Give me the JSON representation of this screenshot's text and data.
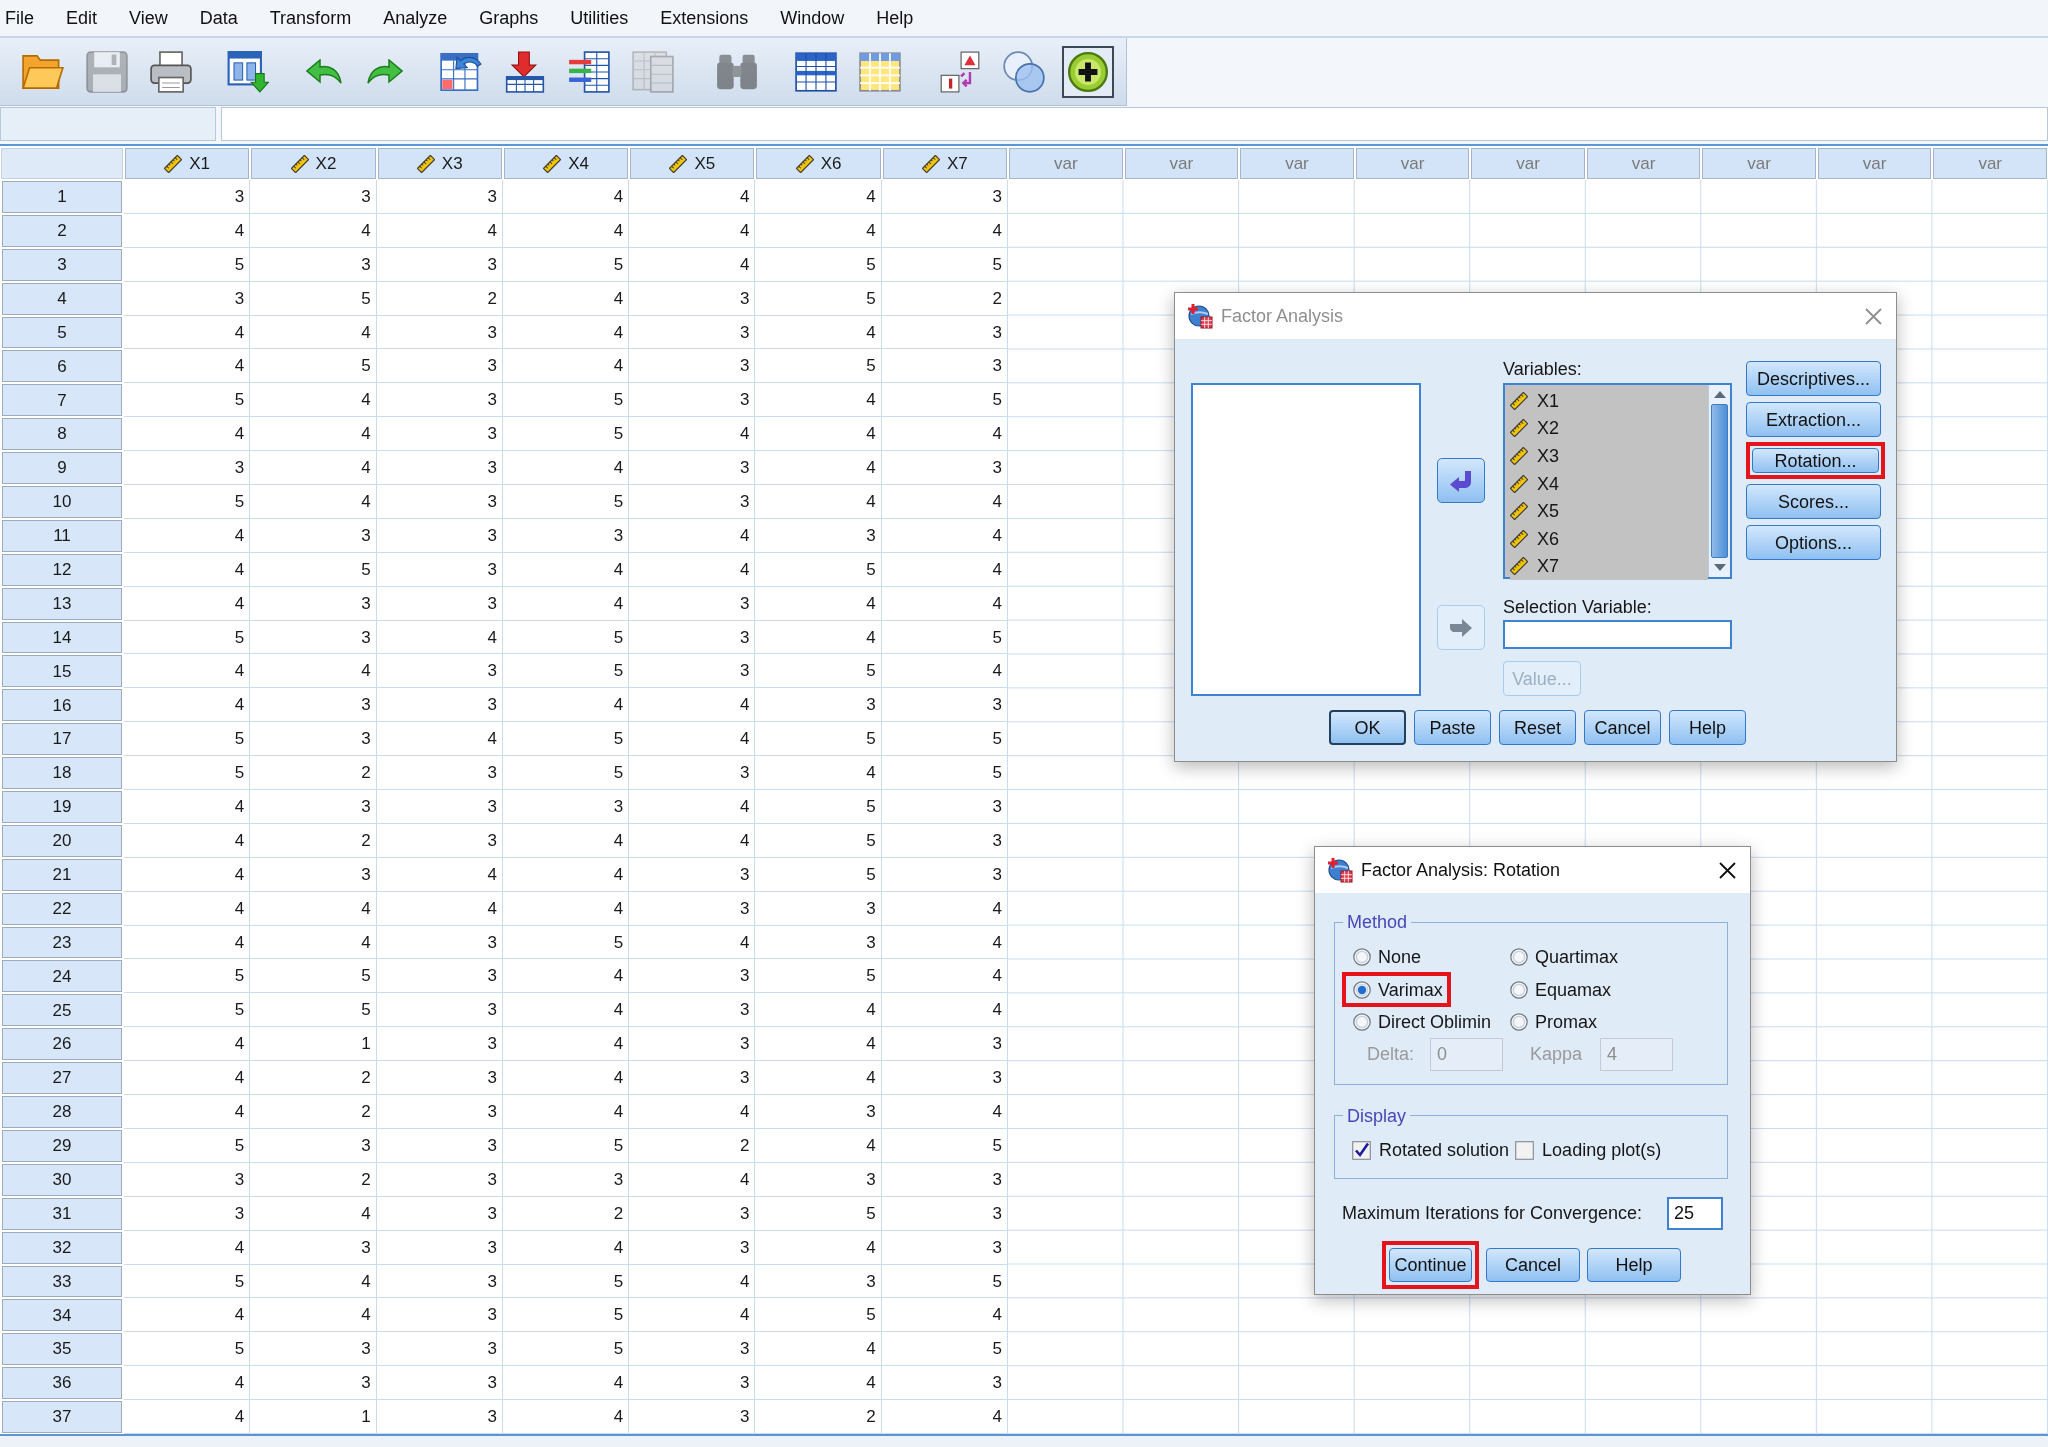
{
  "menu_bar": [
    "File",
    "Edit",
    "View",
    "Data",
    "Transform",
    "Analyze",
    "Graphs",
    "Utilities",
    "Extensions",
    "Window",
    "Help"
  ],
  "toolbar": [
    {
      "disabled": false,
      "on": false
    },
    {
      "disabled": true,
      "on": false
    },
    {
      "disabled": false,
      "on": false
    },
    {
      "disabled": false,
      "on": false
    },
    {
      "disabled": false,
      "on": false
    },
    {
      "disabled": false,
      "on": false
    },
    {
      "disabled": false,
      "on": false
    },
    {
      "disabled": false,
      "on": false
    },
    {
      "disabled": false,
      "on": false
    },
    {
      "disabled": true,
      "on": false
    },
    {
      "disabled": true,
      "on": false
    },
    {
      "disabled": false,
      "on": false
    },
    {
      "disabled": false,
      "on": false
    },
    {
      "disabled": false,
      "on": false
    },
    {
      "disabled": false,
      "on": false
    },
    {
      "disabled": false,
      "on": true
    }
  ],
  "grid": {
    "columns": [
      {
        "label": "X1",
        "kind": "scale"
      },
      {
        "label": "X2",
        "kind": "scale"
      },
      {
        "label": "X3",
        "kind": "scale"
      },
      {
        "label": "X4",
        "kind": "scale"
      },
      {
        "label": "X5",
        "kind": "scale"
      },
      {
        "label": "X6",
        "kind": "scale"
      },
      {
        "label": "X7",
        "kind": "scale"
      },
      {
        "label": "var",
        "kind": "empty"
      },
      {
        "label": "var",
        "kind": "empty"
      },
      {
        "label": "var",
        "kind": "empty"
      },
      {
        "label": "var",
        "kind": "empty"
      },
      {
        "label": "var",
        "kind": "empty"
      },
      {
        "label": "var",
        "kind": "empty"
      },
      {
        "label": "var",
        "kind": "empty"
      },
      {
        "label": "var",
        "kind": "empty"
      },
      {
        "label": "var",
        "kind": "empty"
      }
    ],
    "rows": [
      {
        "number": "1",
        "cells": [
          "3",
          "3",
          "3",
          "4",
          "4",
          "4",
          "3"
        ]
      },
      {
        "number": "2",
        "cells": [
          "4",
          "4",
          "4",
          "4",
          "4",
          "4",
          "4"
        ]
      },
      {
        "number": "3",
        "cells": [
          "5",
          "3",
          "3",
          "5",
          "4",
          "5",
          "5"
        ]
      },
      {
        "number": "4",
        "cells": [
          "3",
          "5",
          "2",
          "4",
          "3",
          "5",
          "2"
        ]
      },
      {
        "number": "5",
        "cells": [
          "4",
          "4",
          "3",
          "4",
          "3",
          "4",
          "3"
        ]
      },
      {
        "number": "6",
        "cells": [
          "4",
          "5",
          "3",
          "4",
          "3",
          "5",
          "3"
        ]
      },
      {
        "number": "7",
        "cells": [
          "5",
          "4",
          "3",
          "5",
          "3",
          "4",
          "5"
        ]
      },
      {
        "number": "8",
        "cells": [
          "4",
          "4",
          "3",
          "5",
          "4",
          "4",
          "4"
        ]
      },
      {
        "number": "9",
        "cells": [
          "3",
          "4",
          "3",
          "4",
          "3",
          "4",
          "3"
        ]
      },
      {
        "number": "10",
        "cells": [
          "5",
          "4",
          "3",
          "5",
          "3",
          "4",
          "4"
        ]
      },
      {
        "number": "11",
        "cells": [
          "4",
          "3",
          "3",
          "3",
          "4",
          "3",
          "4"
        ]
      },
      {
        "number": "12",
        "cells": [
          "4",
          "5",
          "3",
          "4",
          "4",
          "5",
          "4"
        ]
      },
      {
        "number": "13",
        "cells": [
          "4",
          "3",
          "3",
          "4",
          "3",
          "4",
          "4"
        ]
      },
      {
        "number": "14",
        "cells": [
          "5",
          "3",
          "4",
          "5",
          "3",
          "4",
          "5"
        ]
      },
      {
        "number": "15",
        "cells": [
          "4",
          "4",
          "3",
          "5",
          "3",
          "5",
          "4"
        ]
      },
      {
        "number": "16",
        "cells": [
          "4",
          "3",
          "3",
          "4",
          "4",
          "3",
          "3"
        ]
      },
      {
        "number": "17",
        "cells": [
          "5",
          "3",
          "4",
          "5",
          "4",
          "5",
          "5"
        ]
      },
      {
        "number": "18",
        "cells": [
          "5",
          "2",
          "3",
          "5",
          "3",
          "4",
          "5"
        ]
      },
      {
        "number": "19",
        "cells": [
          "4",
          "3",
          "3",
          "3",
          "4",
          "5",
          "3"
        ]
      },
      {
        "number": "20",
        "cells": [
          "4",
          "2",
          "3",
          "4",
          "4",
          "5",
          "3"
        ]
      },
      {
        "number": "21",
        "cells": [
          "4",
          "3",
          "4",
          "4",
          "3",
          "5",
          "3"
        ]
      },
      {
        "number": "22",
        "cells": [
          "4",
          "4",
          "4",
          "4",
          "3",
          "3",
          "4"
        ]
      },
      {
        "number": "23",
        "cells": [
          "4",
          "4",
          "3",
          "5",
          "4",
          "3",
          "4"
        ]
      },
      {
        "number": "24",
        "cells": [
          "5",
          "5",
          "3",
          "4",
          "3",
          "5",
          "4"
        ]
      },
      {
        "number": "25",
        "cells": [
          "5",
          "5",
          "3",
          "4",
          "3",
          "4",
          "4"
        ]
      },
      {
        "number": "26",
        "cells": [
          "4",
          "1",
          "3",
          "4",
          "3",
          "4",
          "3"
        ]
      },
      {
        "number": "27",
        "cells": [
          "4",
          "2",
          "3",
          "4",
          "3",
          "4",
          "3"
        ]
      },
      {
        "number": "28",
        "cells": [
          "4",
          "2",
          "3",
          "4",
          "4",
          "3",
          "4"
        ]
      },
      {
        "number": "29",
        "cells": [
          "5",
          "3",
          "3",
          "5",
          "2",
          "4",
          "5"
        ]
      },
      {
        "number": "30",
        "cells": [
          "3",
          "2",
          "3",
          "3",
          "4",
          "3",
          "3"
        ]
      },
      {
        "number": "31",
        "cells": [
          "3",
          "4",
          "3",
          "2",
          "3",
          "5",
          "3"
        ]
      },
      {
        "number": "32",
        "cells": [
          "4",
          "3",
          "3",
          "4",
          "3",
          "4",
          "3"
        ]
      },
      {
        "number": "33",
        "cells": [
          "5",
          "4",
          "3",
          "5",
          "4",
          "3",
          "5"
        ]
      },
      {
        "number": "34",
        "cells": [
          "4",
          "4",
          "3",
          "5",
          "4",
          "5",
          "4"
        ]
      },
      {
        "number": "35",
        "cells": [
          "5",
          "3",
          "3",
          "5",
          "3",
          "4",
          "5"
        ]
      },
      {
        "number": "36",
        "cells": [
          "4",
          "3",
          "3",
          "4",
          "3",
          "4",
          "3"
        ]
      },
      {
        "number": "37",
        "cells": [
          "4",
          "1",
          "3",
          "4",
          "3",
          "2",
          "4"
        ]
      }
    ]
  },
  "factor_analysis_dialog": {
    "title": "Factor Analysis",
    "active": false,
    "variables_label": "Variables:",
    "variables": [
      {
        "name": "X1",
        "selected": true
      },
      {
        "name": "X2",
        "selected": true
      },
      {
        "name": "X3",
        "selected": true
      },
      {
        "name": "X4",
        "selected": true
      },
      {
        "name": "X5",
        "selected": true
      },
      {
        "name": "X6",
        "selected": true
      },
      {
        "name": "X7",
        "selected": true
      }
    ],
    "move_buttons": [
      {
        "disabled": false
      },
      {
        "disabled": true
      }
    ],
    "selection_variable_label": "Selection Variable:",
    "value_button": {
      "label": "Value...",
      "disabled": true
    },
    "side_buttons": [
      {
        "label": "Descriptives...",
        "highlighted": false
      },
      {
        "label": "Extraction...",
        "highlighted": false
      },
      {
        "label": "Rotation...",
        "highlighted": true
      },
      {
        "label": "Scores...",
        "highlighted": false
      },
      {
        "label": "Options...",
        "highlighted": false
      }
    ],
    "bottom_buttons": [
      {
        "label": "OK",
        "default": true
      },
      {
        "label": "Paste",
        "default": false
      },
      {
        "label": "Reset",
        "default": false
      },
      {
        "label": "Cancel",
        "default": false
      },
      {
        "label": "Help",
        "default": false
      }
    ]
  },
  "rotation_dialog": {
    "title": "Factor Analysis: Rotation",
    "active": true,
    "method": {
      "legend": "Method",
      "options": [
        {
          "label": "None",
          "selected": false,
          "highlighted": false
        },
        {
          "label": "Quartimax",
          "selected": false,
          "highlighted": false
        },
        {
          "label": "Varimax",
          "selected": true,
          "highlighted": true
        },
        {
          "label": "Equamax",
          "selected": false,
          "highlighted": false
        },
        {
          "label": "Direct Oblimin",
          "selected": false,
          "highlighted": false
        },
        {
          "label": "Promax",
          "selected": false,
          "highlighted": false
        }
      ],
      "parameters": [
        {
          "label": "Delta:",
          "value": "0",
          "disabled": true
        },
        {
          "label": "Kappa",
          "value": "4",
          "disabled": true
        }
      ]
    },
    "display": {
      "legend": "Display",
      "options": [
        {
          "label": "Rotated solution",
          "checked": true
        },
        {
          "label": "Loading plot(s)",
          "checked": false
        }
      ]
    },
    "iterations": {
      "label": "Maximum Iterations for Convergence:",
      "value": "25"
    },
    "buttons": [
      {
        "label": "Continue",
        "highlighted": true
      },
      {
        "label": "Cancel",
        "highlighted": false
      },
      {
        "label": "Help",
        "highlighted": false
      }
    ]
  }
}
